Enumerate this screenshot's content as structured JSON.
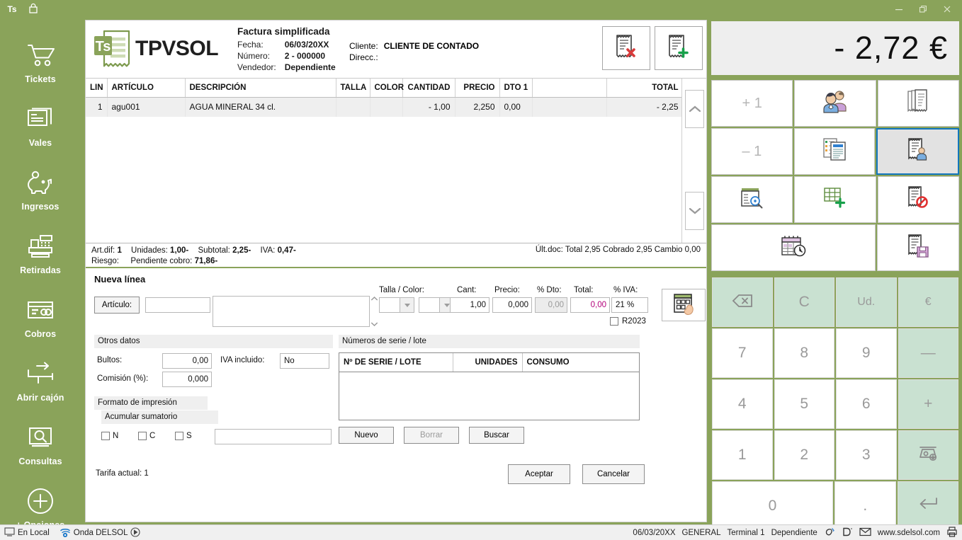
{
  "window": {
    "logo_badge": "Ts",
    "lock_icon": "lock-icon",
    "minimize": "–",
    "maximize": "❐",
    "close": "✕"
  },
  "sidebar": {
    "items": [
      {
        "label": "Tickets",
        "icon": "shopping-cart-icon"
      },
      {
        "label": "Vales",
        "icon": "vouchers-icon"
      },
      {
        "label": "Ingresos",
        "icon": "piggy-bank-icon"
      },
      {
        "label": "Retiradas",
        "icon": "cash-register-icon"
      },
      {
        "label": "Cobros",
        "icon": "credit-card-icon"
      },
      {
        "label": "Abrir cajón",
        "icon": "open-drawer-icon"
      },
      {
        "label": "Consultas",
        "icon": "search-screen-icon"
      },
      {
        "label": "+ Opciones",
        "icon": "plus-circle-icon"
      }
    ]
  },
  "document": {
    "brand": "TPVSOL",
    "brand_badge": "Ts",
    "title": "Factura simplificada",
    "fields": [
      {
        "key": "Fecha:",
        "value": "06/03/20XX"
      },
      {
        "key": "Número:",
        "value": "2 - 000000"
      },
      {
        "key": "Vendedor:",
        "value": "Dependiente"
      }
    ],
    "customer": [
      {
        "key": "Cliente:",
        "value": "CLIENTE DE CONTADO"
      },
      {
        "key": "Direcc.:",
        "value": ""
      }
    ],
    "header_buttons": [
      {
        "name": "delete-document-button",
        "icon": "receipt-delete-icon"
      },
      {
        "name": "new-document-button",
        "icon": "receipt-add-icon"
      }
    ]
  },
  "lines_table": {
    "columns": [
      "LIN",
      "ARTÍCULO",
      "DESCRIPCIÓN",
      "TALLA",
      "COLOR",
      "CANTIDAD",
      "PRECIO",
      "DTO 1",
      "",
      "TOTAL"
    ],
    "rows": [
      {
        "lin": "1",
        "articulo": "agu001",
        "descripcion": "AGUA MINERAL 34 cl.",
        "talla": "",
        "color": "",
        "cantidad": "- 1,00",
        "precio": "2,250",
        "dto1": "0,00",
        "blank": "",
        "total": "- 2,25"
      }
    ],
    "scroll_up": "chevron-up-icon",
    "scroll_down": "chevron-down-icon"
  },
  "totals": {
    "artdif_label": "Art.dif:",
    "artdif_value": "1",
    "unidades_label": "Unidades:",
    "unidades_value": "1,00-",
    "subtotal_label": "Subtotal:",
    "subtotal_value": "2,25-",
    "iva_label": "IVA:",
    "iva_value": "0,47-",
    "riesgo_label": "Riesgo:",
    "riesgo_value": "",
    "pendiente_label": "Pendiente cobro:",
    "pendiente_value": "71,86-",
    "last_doc": "Últ.doc: Total 2,95 Cobrado 2,95 Cambio 0,00"
  },
  "new_line": {
    "title": "Nueva línea",
    "articulo_button": "Artículo:",
    "articulo_code": "",
    "articulo_desc": "",
    "talla_color_label": "Talla / Color:",
    "talla_value": "",
    "color_value": "",
    "cant_label": "Cant:",
    "cant_value": "1,00",
    "precio_label": "Precio:",
    "precio_value": "0,000",
    "dto_label": "% Dto:",
    "dto_value": "0,00",
    "total_label": "Total:",
    "total_value": "0,00",
    "iva_label": "% IVA:",
    "iva_value": "21 %",
    "r2023_label": "R2023",
    "calculator_button": "keypad-hand-icon",
    "otros_datos": {
      "header": "Otros datos",
      "bultos_label": "Bultos:",
      "bultos_value": "0,00",
      "comision_label": "Comisión (%):",
      "comision_value": "0,000",
      "iva_incluido_label": "IVA incluido:",
      "iva_incluido_value": "No"
    },
    "formato": {
      "header": "Formato de impresión",
      "options": [
        "N",
        "C",
        "S"
      ]
    },
    "acumular": {
      "header": "Acumular sumatorio",
      "value": ""
    },
    "serie": {
      "header": "Números de serie / lote",
      "columns": [
        "Nº DE SERIE / LOTE",
        "UNIDADES",
        "CONSUMO"
      ],
      "rows": [],
      "buttons": [
        "Nuevo",
        "Borrar",
        "Buscar"
      ]
    },
    "tarifa": "Tarifa actual: 1",
    "accept": "Aceptar",
    "cancel": "Cancelar"
  },
  "right_panel": {
    "total": "- 2,72 €",
    "icon_grid": [
      [
        {
          "label": "+ 1",
          "icon": "plus-one-icon",
          "name": "increment-button",
          "selected": false
        },
        {
          "label": "",
          "icon": "customers-icon",
          "name": "customers-button",
          "selected": false
        },
        {
          "label": "",
          "icon": "receipts-stack-icon",
          "name": "receipts-list-button",
          "selected": false
        }
      ],
      [
        {
          "label": "– 1",
          "icon": "minus-one-icon",
          "name": "decrement-button",
          "selected": false
        },
        {
          "label": "",
          "icon": "documents-copy-icon",
          "name": "documents-button",
          "selected": false
        },
        {
          "label": "",
          "icon": "receipt-person-icon",
          "name": "receipt-customer-button",
          "selected": true
        }
      ],
      [
        {
          "label": "",
          "icon": "document-search-icon",
          "name": "document-search-button",
          "selected": false
        },
        {
          "label": "",
          "icon": "table-add-icon",
          "name": "table-add-button",
          "selected": false
        },
        {
          "label": "",
          "icon": "receipt-cancel-icon",
          "name": "receipt-cancel-button",
          "selected": false
        }
      ],
      [
        {
          "label": "",
          "icon": "calendar-clock-icon",
          "name": "schedule-button",
          "selected": false,
          "wide": true
        },
        {
          "label": "",
          "icon": "receipt-save-icon",
          "name": "receipt-save-button",
          "selected": false
        }
      ]
    ],
    "keypad": [
      [
        {
          "label": "⌫",
          "name": "backspace-key",
          "green": true,
          "small": true
        },
        {
          "label": "C",
          "name": "clear-key",
          "green": true,
          "small": false
        },
        {
          "label": "Ud.",
          "name": "units-key",
          "green": true,
          "small": true
        },
        {
          "label": "€",
          "name": "euro-key",
          "green": true,
          "small": true
        }
      ],
      [
        {
          "label": "7",
          "name": "key-7",
          "green": false
        },
        {
          "label": "8",
          "name": "key-8",
          "green": false
        },
        {
          "label": "9",
          "name": "key-9",
          "green": false
        },
        {
          "label": "—",
          "name": "minus-key",
          "green": true
        }
      ],
      [
        {
          "label": "4",
          "name": "key-4",
          "green": false
        },
        {
          "label": "5",
          "name": "key-5",
          "green": false
        },
        {
          "label": "6",
          "name": "key-6",
          "green": false
        },
        {
          "label": "+",
          "name": "plus-key",
          "green": true
        }
      ],
      [
        {
          "label": "1",
          "name": "key-1",
          "green": false
        },
        {
          "label": "2",
          "name": "key-2",
          "green": false
        },
        {
          "label": "3",
          "name": "key-3",
          "green": false
        },
        {
          "label": "",
          "name": "scale-key",
          "green": true,
          "icon": "scale-icon"
        }
      ],
      [
        {
          "label": "0",
          "name": "key-0",
          "green": false,
          "wide": true
        },
        {
          "label": ".",
          "name": "decimal-key",
          "green": false
        },
        {
          "label": "↵",
          "name": "enter-key",
          "green": true
        }
      ]
    ]
  },
  "status_bar": {
    "local_label": "En Local",
    "onda_label": "Onda DELSOL",
    "date": "06/03/20XX",
    "company": "GENERAL",
    "terminal": "Terminal 1",
    "user": "Dependiente",
    "website": "www.sdelsol.com"
  },
  "colors": {
    "brand_green": "#8aa35a",
    "keypad_green": "#c9e1d1",
    "selected_blue": "#1176bd",
    "total_bg": "#eeeeee"
  }
}
